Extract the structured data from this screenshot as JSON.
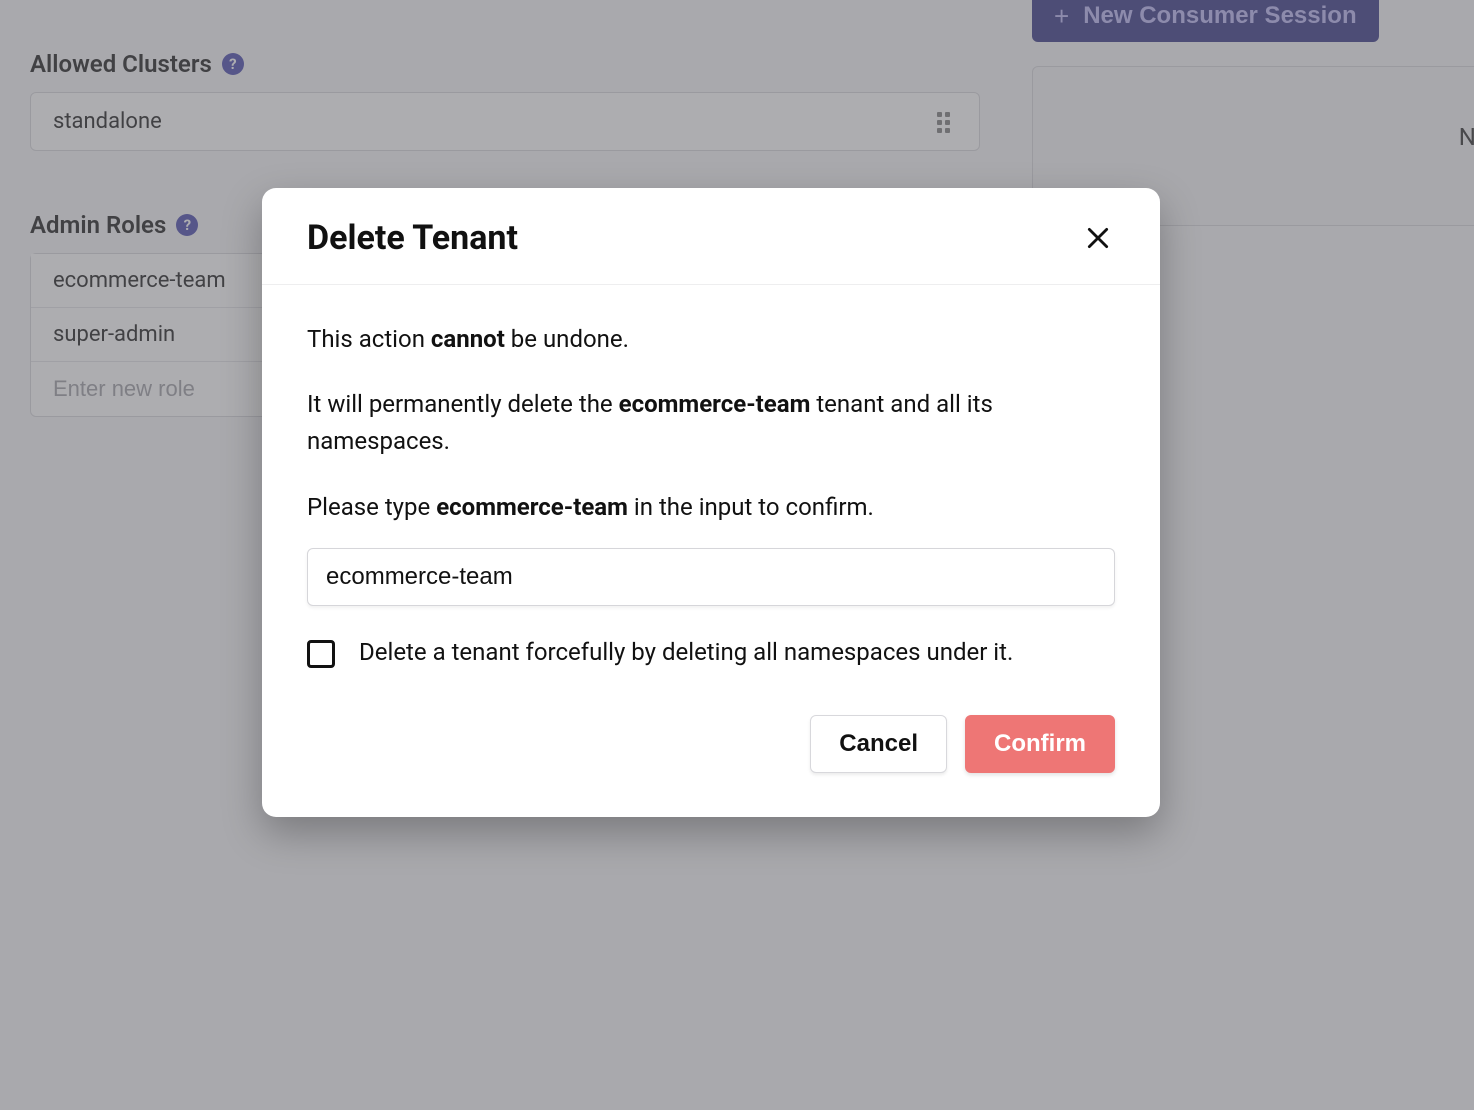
{
  "background": {
    "allowed_clusters_label": "Allowed Clusters",
    "cluster_value": "standalone",
    "admin_roles_label": "Admin Roles",
    "roles": [
      "ecommerce-team",
      "super-admin"
    ],
    "role_input_placeholder": "Enter new role",
    "new_session_button": "New Consumer Session",
    "no_item_text": "No item"
  },
  "modal": {
    "title": "Delete Tenant",
    "warn_prefix": "This action ",
    "warn_bold": "cannot",
    "warn_suffix": " be undone.",
    "body_prefix": "It will permanently delete the ",
    "body_bold": "ecommerce-team",
    "body_suffix": " tenant and all its namespaces.",
    "confirm_prefix": "Please type ",
    "confirm_bold": "ecommerce-team",
    "confirm_suffix": " in the input to confirm.",
    "input_value": "ecommerce-team",
    "force_checkbox_label": "Delete a tenant forcefully by deleting all namespaces under it.",
    "cancel_label": "Cancel",
    "confirm_label": "Confirm"
  }
}
